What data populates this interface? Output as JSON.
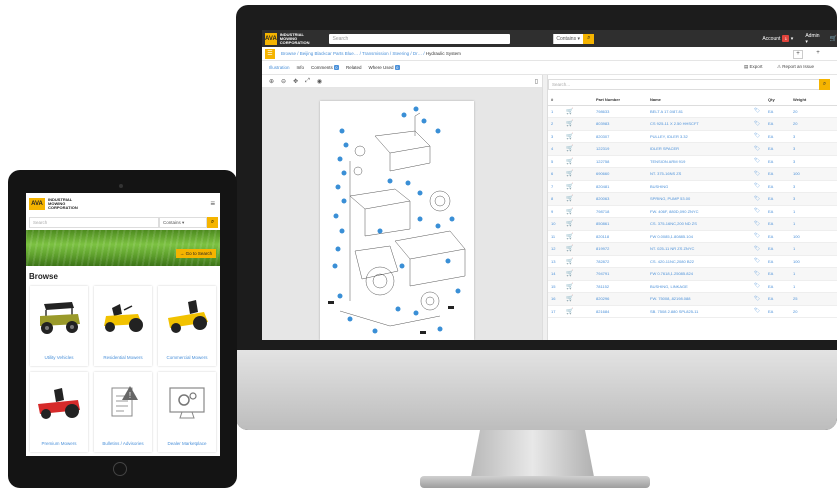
{
  "desktop": {
    "header": {
      "logo_mark": "AVA",
      "logo_text": "INDUSTRIAL MOWING CORPORATION",
      "search_placeholder": "Search",
      "contains_label": "Contains",
      "account_label": "Account",
      "account_badge": "1",
      "admin_label": "Admin"
    },
    "breadcrumb": {
      "items": [
        "Browse",
        "Beijing Blackcar Parts Blue…",
        "Transmission / Steering / Dr…"
      ],
      "current": "Hydraulic System"
    },
    "tabs": [
      {
        "label": "Illustration",
        "count": ""
      },
      {
        "label": "Info",
        "count": ""
      },
      {
        "label": "Comments",
        "count": "0"
      },
      {
        "label": "Related",
        "count": ""
      },
      {
        "label": "Where Used",
        "count": "0"
      }
    ],
    "actions": {
      "export_label": "Export",
      "report_label": "Report an Issue"
    },
    "parts_search_placeholder": "Search...",
    "table": {
      "headers": [
        "#",
        "",
        "Part Number",
        "Name",
        "",
        "Qty",
        "Weight"
      ],
      "rows": [
        [
          "1",
          "798633",
          "BELT A 17.0/87.81",
          "EA",
          "20"
        ],
        [
          "2",
          "803983",
          "CS 925-11 X 2.50 HHSCFT",
          "EA",
          "20"
        ],
        [
          "3",
          "820307",
          "PULLEY, IDLER 3.32",
          "EA",
          "3"
        ],
        [
          "4",
          "122319",
          "IDLER SPACER",
          "EA",
          "3"
        ],
        [
          "5",
          "122758",
          "TENSION ARM 919",
          "EA",
          "3"
        ],
        [
          "6",
          "690660",
          "NT. 375-16NS ZS",
          "EA",
          "100"
        ],
        [
          "7",
          "820481",
          "BUSHING",
          "EA",
          "3"
        ],
        [
          "8",
          "820063",
          "SPRING, PUMP 53.00",
          "EA",
          "3"
        ],
        [
          "9",
          "798718",
          "FW. 406F, 880D,090 ZNYC",
          "EA",
          "1"
        ],
        [
          "10",
          "850861",
          "CS. 375-16NC,200 ND ZS",
          "EA",
          "1"
        ],
        [
          "11",
          "820118",
          "FW 0.0085,1.80885.104",
          "EA",
          "100"
        ],
        [
          "12",
          "819972",
          "NT. 025-11 NR ZS ZNYC",
          "EA",
          "1"
        ],
        [
          "13",
          "782872",
          "CS. 420-11NC,2080 B22",
          "EA",
          "100"
        ],
        [
          "14",
          "794791",
          "FW 0.7618,1.25085.824",
          "EA",
          "1"
        ],
        [
          "15",
          "781152",
          "BUSHING, LINKAGE",
          "EA",
          "1"
        ],
        [
          "16",
          "820296",
          "FW. 75008,.82198.088",
          "EA",
          "25"
        ],
        [
          "17",
          "821684",
          "SB. 7508 2.880 SPL825-11",
          "EA",
          "20"
        ]
      ]
    }
  },
  "tablet": {
    "logo_mark": "AVA",
    "logo_text": "INDUSTRIAL MOWING CORPORATION",
    "search_placeholder": "Search",
    "contains_label": "Contains",
    "goto_label": "→ Go to Search",
    "browse_title": "Browse",
    "categories": [
      "Utility Vehicles",
      "Residential Mowers",
      "Commercial Mowers",
      "Premium Mowers",
      "Bulletins / Advisories",
      "Dealer Marketplace"
    ]
  }
}
